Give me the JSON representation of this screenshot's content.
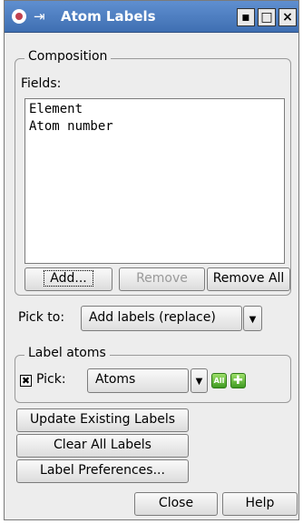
{
  "window": {
    "title": "Atom Labels"
  },
  "composition": {
    "legend": "Composition",
    "fields_label": "Fields:",
    "fields": [
      "Element",
      "Atom number"
    ],
    "add_label": "Add...",
    "remove_label": "Remove",
    "remove_all_label": "Remove All"
  },
  "pick_to": {
    "label": "Pick to:",
    "value": "Add labels (replace)"
  },
  "label_atoms": {
    "legend": "Label atoms",
    "pick_checked": true,
    "pick_label": "Pick:",
    "pick_value": "Atoms",
    "all_label": "All"
  },
  "actions": {
    "update_label": "Update Existing Labels",
    "clear_label": "Clear All Labels",
    "prefs_label": "Label Preferences..."
  },
  "footer": {
    "close_label": "Close",
    "help_label": "Help"
  },
  "colors": {
    "titlebar": "#4a7cc0",
    "accent_green": "#4caf2a"
  }
}
